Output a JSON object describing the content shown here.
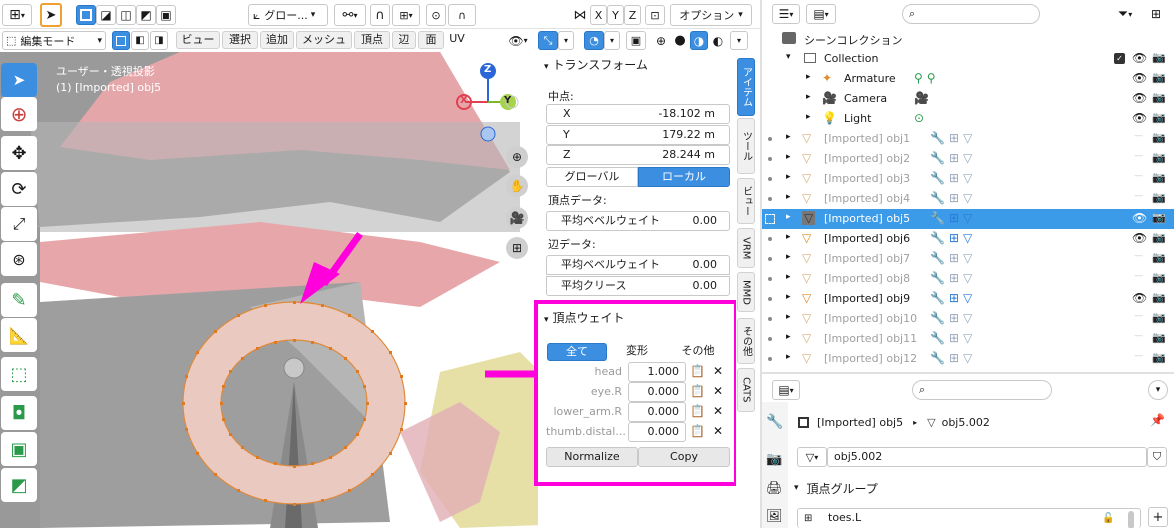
{
  "header": {
    "view3d_icon": "globe-axis-icon",
    "transform_orientation": "グロー...",
    "xyz": [
      "X",
      "Y",
      "Z"
    ],
    "options_label": "オプション"
  },
  "toolbar": {
    "mode": "編集モード",
    "menus": [
      "ビュー",
      "選択",
      "追加",
      "メッシュ",
      "頂点",
      "辺",
      "面",
      "UV"
    ]
  },
  "viewport": {
    "view_label": "ユーザー・透視投影",
    "object_label": "(1) [Imported] obj5",
    "gizmo": {
      "x": "X",
      "y": "Y",
      "z": "Z"
    },
    "annotation_color": "#ff00dd"
  },
  "npanel": {
    "transform_title": "トランスフォーム",
    "median_label": "中点:",
    "coords": [
      {
        "axis": "X",
        "value": "-18.102 m"
      },
      {
        "axis": "Y",
        "value": "179.22 m"
      },
      {
        "axis": "Z",
        "value": "28.244 m"
      }
    ],
    "global_label": "グローバル",
    "local_label": "ローカル",
    "vertex_data_label": "頂点データ:",
    "vertex_bevel_label": "平均ベベルウェイト",
    "vertex_bevel_value": "0.00",
    "edge_data_label": "辺データ:",
    "edge_bevel_label": "平均ベベルウェイト",
    "edge_bevel_value": "0.00",
    "crease_label": "平均クリース",
    "crease_value": "0.00",
    "vw_title": "頂点ウェイト",
    "vw_tabs": [
      "全て",
      "変形",
      "その他"
    ],
    "weights": [
      {
        "name": "head",
        "value": "1.000"
      },
      {
        "name": "eye.R",
        "value": "0.000"
      },
      {
        "name": "lower_arm.R",
        "value": "0.000"
      },
      {
        "name": "thumb.distal...",
        "value": "0.000"
      }
    ],
    "normalize_label": "Normalize",
    "copy_label": "Copy",
    "side_tabs": [
      "アイテム",
      "ツール",
      "ビュー",
      "VRM",
      "MMD",
      "その他",
      "CATS"
    ]
  },
  "outliner": {
    "scene_collection": "シーンコレクション",
    "collection": "Collection",
    "items": [
      {
        "name": "Armature",
        "indent": 1,
        "visible": true,
        "dim": false,
        "selected": false
      },
      {
        "name": "Camera",
        "indent": 1,
        "visible": true,
        "dim": false,
        "selected": false
      },
      {
        "name": "Light",
        "indent": 1,
        "visible": true,
        "dim": false,
        "selected": false
      },
      {
        "name": "[Imported] obj1",
        "indent": 0,
        "visible": false,
        "dim": true,
        "selected": false
      },
      {
        "name": "[Imported] obj2",
        "indent": 0,
        "visible": false,
        "dim": true,
        "selected": false
      },
      {
        "name": "[Imported] obj3",
        "indent": 0,
        "visible": false,
        "dim": true,
        "selected": false
      },
      {
        "name": "[Imported] obj4",
        "indent": 0,
        "visible": false,
        "dim": true,
        "selected": false
      },
      {
        "name": "[Imported] obj5",
        "indent": 0,
        "visible": true,
        "dim": false,
        "selected": true
      },
      {
        "name": "[Imported] obj6",
        "indent": 0,
        "visible": true,
        "dim": false,
        "selected": false
      },
      {
        "name": "[Imported] obj7",
        "indent": 0,
        "visible": false,
        "dim": true,
        "selected": false
      },
      {
        "name": "[Imported] obj8",
        "indent": 0,
        "visible": false,
        "dim": true,
        "selected": false
      },
      {
        "name": "[Imported] obj9",
        "indent": 0,
        "visible": true,
        "dim": false,
        "selected": false
      },
      {
        "name": "[Imported] obj10",
        "indent": 0,
        "visible": false,
        "dim": true,
        "selected": false
      },
      {
        "name": "[Imported] obj11",
        "indent": 0,
        "visible": false,
        "dim": true,
        "selected": false
      },
      {
        "name": "[Imported] obj12",
        "indent": 0,
        "visible": false,
        "dim": true,
        "selected": false
      }
    ]
  },
  "properties": {
    "object_name": "[Imported] obj5",
    "mesh_name": "obj5.002",
    "mesh_field": "obj5.002",
    "vertex_groups_title": "頂点グループ",
    "first_group": "toes.L"
  }
}
